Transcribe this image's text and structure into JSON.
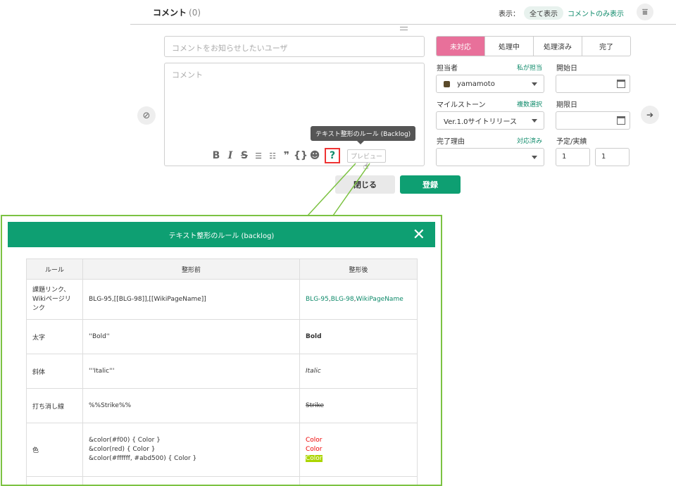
{
  "header": {
    "title": "コメント",
    "count": "(0)",
    "display_label": "表示：",
    "filter_all": "全て表示",
    "filter_comments": "コメントのみ表示"
  },
  "form": {
    "notify_placeholder": "コメントをお知らせしたいユーザ",
    "comment_placeholder": "コメント",
    "toolbar": {
      "bold": "B",
      "italic": "I",
      "strike": "S",
      "bullet": "☰",
      "numbered": "☷",
      "quote": "❞",
      "code": "{}",
      "emoji": "☻",
      "help": "?",
      "preview": "プレビュー"
    },
    "tooltip": "テキスト整形のルール (Backlog)",
    "close_button": "閉じる",
    "save_button": "登録"
  },
  "status": [
    "未対応",
    "処理中",
    "処理済み",
    "完了"
  ],
  "fields": {
    "assignee_label": "担当者",
    "assignee_link": "私が担当",
    "assignee_value": "yamamoto",
    "start_label": "開始日",
    "milestone_label": "マイルストーン",
    "milestone_link": "複数選択",
    "milestone_value": "Ver.1.0サイトリリース",
    "due_label": "期限日",
    "resolution_label": "完了理由",
    "resolution_link": "対応済み",
    "estimate_label": "予定/実績",
    "estimate_value": "1",
    "actual_value": "1"
  },
  "panel": {
    "title": "テキスト整形のルール (backlog)",
    "columns": [
      "ルール",
      "整形前",
      "整形後"
    ],
    "rows": {
      "link": {
        "rule": "課題リンク、Wikiページリンク",
        "before": "BLG-95,[[BLG-98]],[[WikiPageName]]",
        "after_a": "BLG-95",
        "after_sep1": ",",
        "after_b": "BLG-98",
        "after_sep2": ",",
        "after_c": "WikiPageName"
      },
      "bold": {
        "rule": "太字",
        "before": "''Bold''",
        "after": "Bold"
      },
      "italic": {
        "rule": "斜体",
        "before": "'''Italic'''",
        "after": "Italic"
      },
      "strike": {
        "rule": "打ち消し線",
        "before": "%%Strike%%",
        "after": "Strike"
      },
      "color": {
        "rule": "色",
        "before_1": "&color(#f00) { Color }",
        "before_2": "&color(red) { Color }",
        "before_3": "&color(#ffffff, #abd500) { Color }",
        "after": "Color"
      }
    }
  },
  "colors": {
    "accent": "#0e9f72",
    "status_active": "#e8709a",
    "callout": "#7cc242",
    "highlight": "#abd500",
    "danger": "#e33333"
  }
}
